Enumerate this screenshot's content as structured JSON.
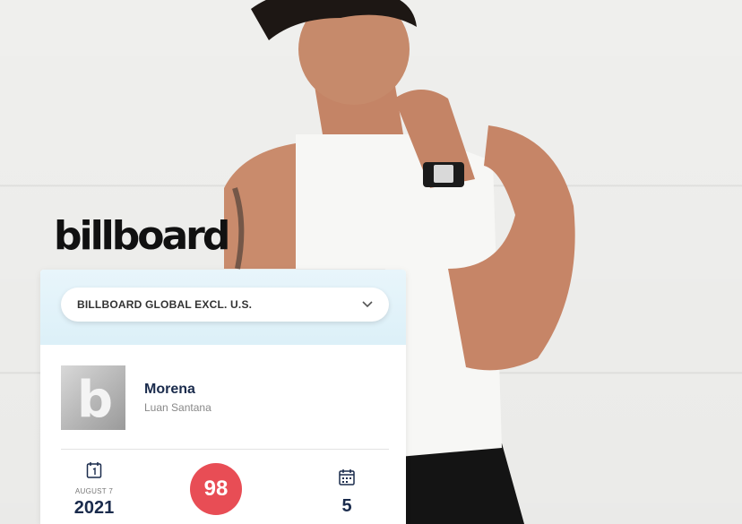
{
  "brand": {
    "logo_text": "billboard"
  },
  "chart_selector": {
    "selected": "BILLBOARD GLOBAL EXCL. U.S."
  },
  "song": {
    "title": "Morena",
    "artist": "Luan Santana"
  },
  "stats": {
    "debut_date": "AUGUST 7",
    "debut_year": "2021",
    "peak_rank": "98",
    "weeks_on_chart": "5"
  },
  "colors": {
    "rank_badge": "#e84d55",
    "header_tint": "#dcf0f8",
    "title": "#1a2b4c"
  },
  "icons": {
    "date": "calendar-day-icon",
    "weeks": "calendar-grid-icon",
    "dropdown": "chevron-down-icon"
  }
}
